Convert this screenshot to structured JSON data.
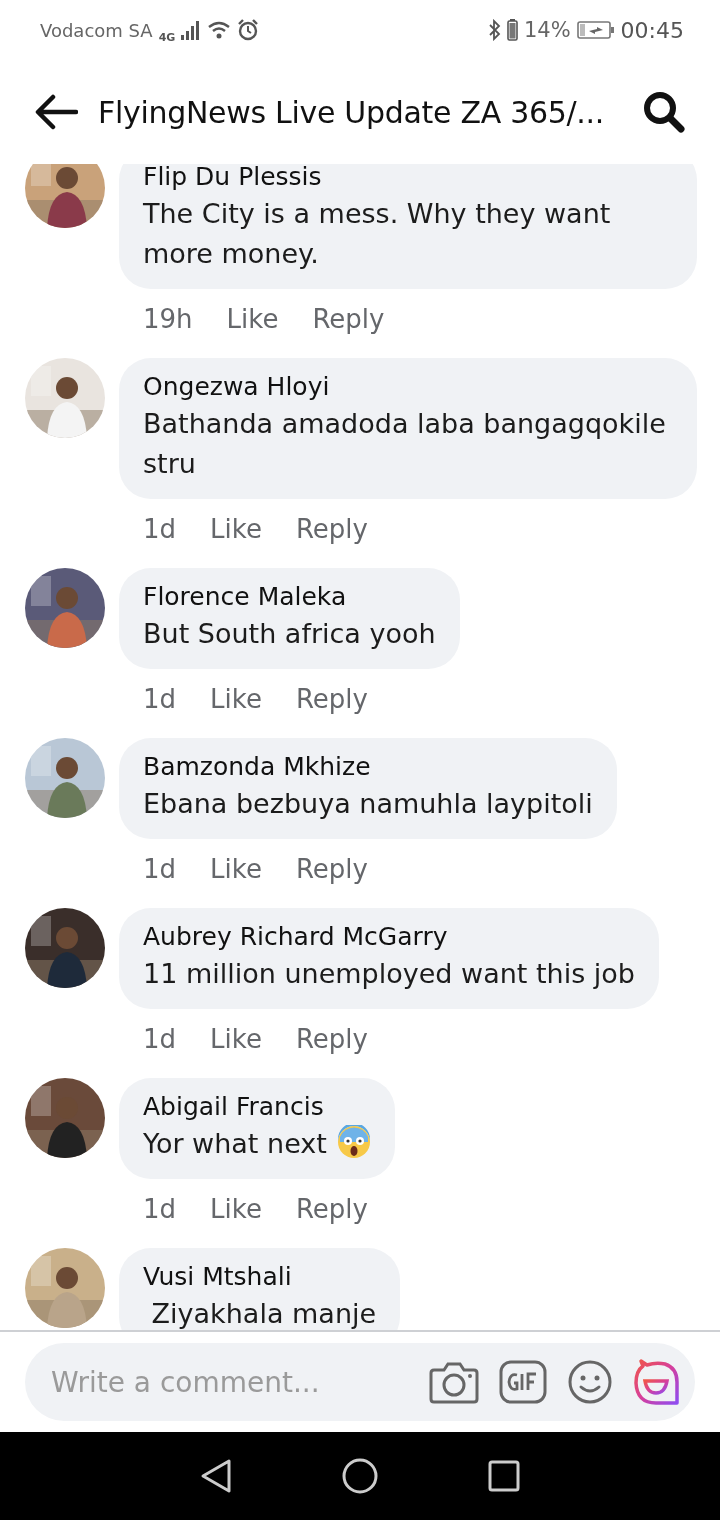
{
  "status_bar": {
    "carrier": "Vodacom SA",
    "network": "4G",
    "battery": "14%",
    "time": "00:45"
  },
  "header": {
    "title": "FlyingNews Live Update ZA 365/..."
  },
  "comments": [
    {
      "kind": "plain",
      "name": "Flip Du Plessis",
      "text": "The City is a mess. Why they want more money.",
      "time": "19h",
      "like": "Like",
      "reply": "Reply"
    },
    {
      "kind": "plain",
      "name": "Ongezwa Hloyi",
      "text": "Bathanda amadoda laba bangagqokile stru",
      "time": "1d",
      "like": "Like",
      "reply": "Reply"
    },
    {
      "kind": "plain",
      "name": "Florence Maleka",
      "text": "But South africa yooh",
      "time": "1d",
      "like": "Like",
      "reply": "Reply"
    },
    {
      "kind": "plain",
      "name": "Bamzonda Mkhize",
      "text": "Ebana bezbuya namuhla laypitoli",
      "time": "1d",
      "like": "Like",
      "reply": "Reply"
    },
    {
      "kind": "plain",
      "name": "Aubrey Richard McGarry",
      "text": "11 million unemployed want this job",
      "time": "1d",
      "like": "Like",
      "reply": "Reply"
    },
    {
      "kind": "with-emoji",
      "name": "Abigail Francis",
      "text": "Yor what next",
      "time": "1d",
      "like": "Like",
      "reply": "Reply"
    },
    {
      "kind": "plain",
      "name": "Vusi Mtshali",
      "text": " Ziyakhala manje"
    }
  ],
  "composer": {
    "placeholder": "Write a comment..."
  }
}
